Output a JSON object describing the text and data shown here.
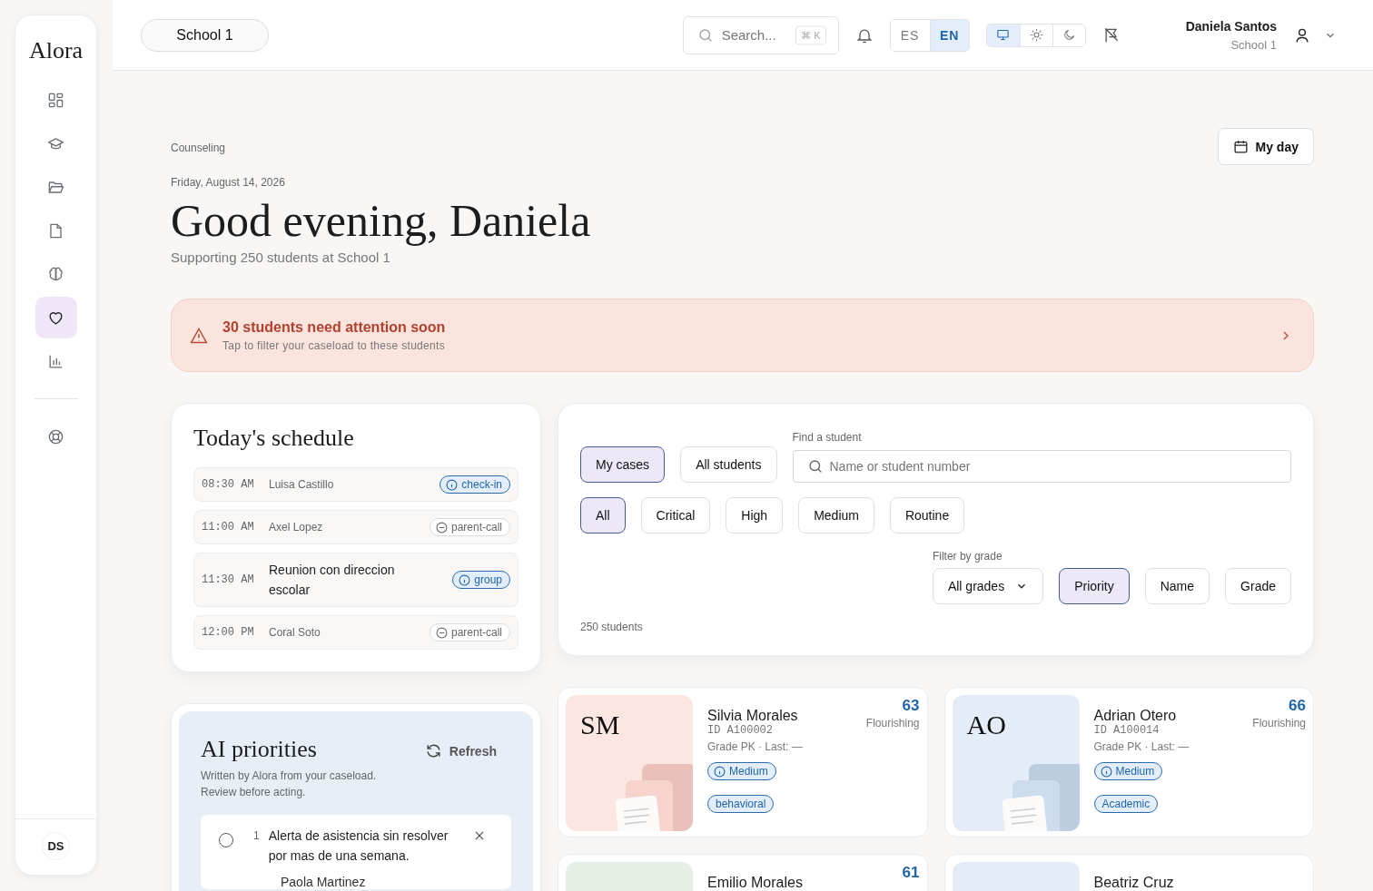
{
  "sidebar": {
    "logo": "Alora",
    "nav": [
      {
        "selected": false
      },
      {
        "selected": false
      },
      {
        "selected": false
      },
      {
        "selected": false
      },
      {
        "selected": false
      },
      {
        "selected": true
      },
      {
        "selected": false
      }
    ],
    "avatar": "DS"
  },
  "topbar": {
    "school": "School 1",
    "search": {
      "placeholder": "Search...",
      "shortcut": "⌘ K"
    },
    "languages": [
      {
        "label": "ES",
        "selected": false
      },
      {
        "label": "EN",
        "selected": true
      }
    ],
    "themes": [
      {
        "selected": true
      },
      {
        "selected": false
      },
      {
        "selected": false
      }
    ],
    "user": {
      "name": "Daniela Santos",
      "school": "School 1"
    }
  },
  "header": {
    "section": "Counseling",
    "date": "Friday, August 14, 2026",
    "greeting": "Good evening, Daniela",
    "subtitle": "Supporting 250 students at School 1",
    "my_day_button": "My day"
  },
  "alert": {
    "title": "30 students need attention soon",
    "subtitle": "Tap to filter your caseload to these students"
  },
  "schedule": {
    "title": "Today's schedule",
    "items": [
      {
        "time": "08:30 AM",
        "name": "Luisa Castillo",
        "kind": "student",
        "tag": {
          "label": "check-in",
          "kind": "info"
        }
      },
      {
        "time": "11:00 AM",
        "name": "Axel Lopez",
        "kind": "student",
        "tag": {
          "label": "parent-call",
          "kind": "neutral"
        }
      },
      {
        "time": "11:30 AM",
        "name": "Reunion con direccion escolar",
        "kind": "meeting",
        "tag": {
          "label": "group",
          "kind": "info"
        }
      },
      {
        "time": "12:00 PM",
        "name": "Coral Soto",
        "kind": "student",
        "tag": {
          "label": "parent-call",
          "kind": "neutral"
        }
      }
    ]
  },
  "ai_priorities": {
    "title": "AI priorities",
    "subtitle": "Written by Alora from your caseload. Review before acting.",
    "refresh_button": "Refresh",
    "items": [
      {
        "number": "1",
        "text": "Alerta de asistencia sin resolver por mas de una semana.",
        "student": "Paola Martinez",
        "checked": false
      }
    ]
  },
  "filters": {
    "scope": [
      {
        "label": "My cases",
        "selected": true
      },
      {
        "label": "All students",
        "selected": false
      }
    ],
    "search_label": "Find a student",
    "search_placeholder": "Name or student number",
    "priorities": [
      {
        "label": "All",
        "selected": true
      },
      {
        "label": "Critical",
        "selected": false
      },
      {
        "label": "High",
        "selected": false
      },
      {
        "label": "Medium",
        "selected": false
      },
      {
        "label": "Routine",
        "selected": false
      }
    ],
    "grade_label": "Filter by grade",
    "grade_value": "All grades",
    "sort": [
      {
        "label": "Priority",
        "selected": true
      },
      {
        "label": "Name",
        "selected": false
      },
      {
        "label": "Grade",
        "selected": false
      }
    ],
    "count": "250 students"
  },
  "students": [
    {
      "initials": "SM",
      "name": "Silvia Morales",
      "id": "ID A100002",
      "meta": "Grade PK · Last: —",
      "score": "63",
      "status": "Flourishing",
      "priority": "Medium",
      "tag": "behavioral",
      "color": "#fbe6e2"
    },
    {
      "initials": "AO",
      "name": "Adrian Otero",
      "id": "ID A100014",
      "meta": "Grade PK · Last: —",
      "score": "66",
      "status": "Flourishing",
      "priority": "Medium",
      "tag": "Academic",
      "color": "#e4edf7"
    },
    {
      "name": "Emilio Morales",
      "score": "61",
      "color": "#e6efe6"
    },
    {
      "name": "Beatriz Cruz",
      "color": "#e4edf7"
    }
  ]
}
